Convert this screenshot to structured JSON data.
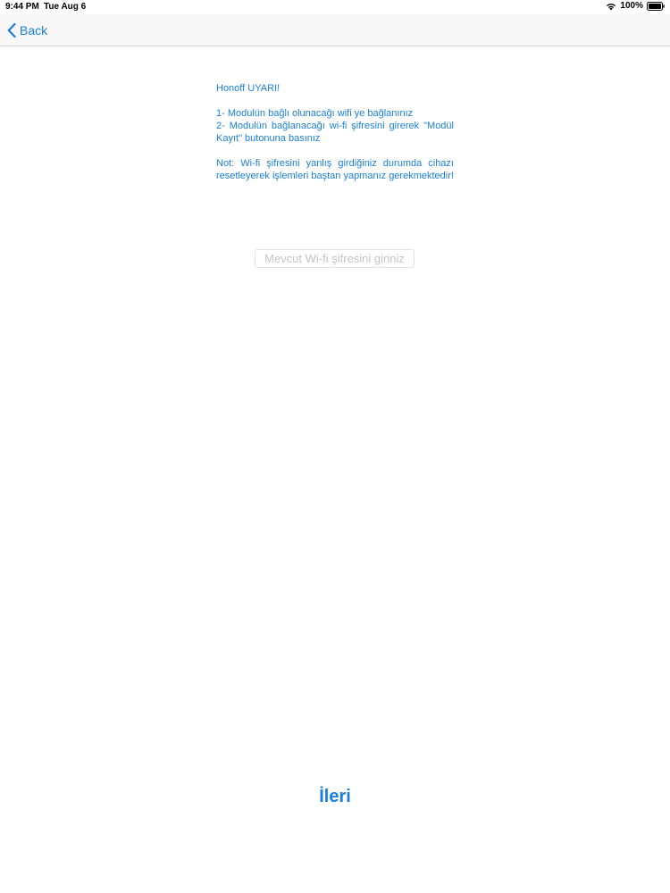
{
  "status_bar": {
    "time": "9:44 PM",
    "date": "Tue Aug 6",
    "battery": "100%",
    "wifi_icon": "wifi-icon",
    "battery_icon": "battery-icon"
  },
  "nav": {
    "back_label": "Back",
    "back_icon": "chevron-left-icon"
  },
  "warning": {
    "title": "Honoff UYARI!",
    "step1": "1-  Modulün bağlı olunacağı wifi ye bağlanınız",
    "step2": "2- Modulün bağlanacağı wi-fi şifresini girerek \"Modül Kayıt\" butonuna basınız",
    "note": "Not: Wi-fi şifresini yanlış girdiğiniz durumda cihazı resetleyerek işlemleri baştan yapmanız gerekmektedir!"
  },
  "form": {
    "password_placeholder": "Mevcut Wi-fi şifresini giriniz",
    "password_value": ""
  },
  "actions": {
    "next_label": "İleri"
  },
  "colors": {
    "accent": "#1a7fdb",
    "navbar_bg": "#f7f7f7",
    "placeholder": "#c4c4c4"
  }
}
